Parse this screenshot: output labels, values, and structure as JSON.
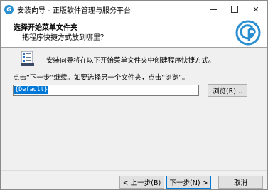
{
  "window": {
    "title": "安装向导 - 正版软件管理与服务平台",
    "app_icon_glyph": "G"
  },
  "titlebar": {
    "close_glyph": "✕"
  },
  "header": {
    "title": "选择开始菜单文件夹",
    "subtitle": "把程序快捷方式放到哪里？",
    "logo_icon": "gp-logo-icon"
  },
  "main": {
    "intro": "安装向导将在以下开始菜单文件夹中创建程序快捷方式。",
    "instruction": "点击“下一步”继续。如要选择另一个文件夹，点击“浏览”。",
    "folder_value": "{Default}",
    "browse_label": "浏览(R)..."
  },
  "footer": {
    "back_label": "< 上一步(B)",
    "next_label": "下一步(N) >",
    "cancel_label": "取消"
  },
  "colors": {
    "accent": "#0078d7",
    "logo_blue": "#2a8fd0"
  }
}
